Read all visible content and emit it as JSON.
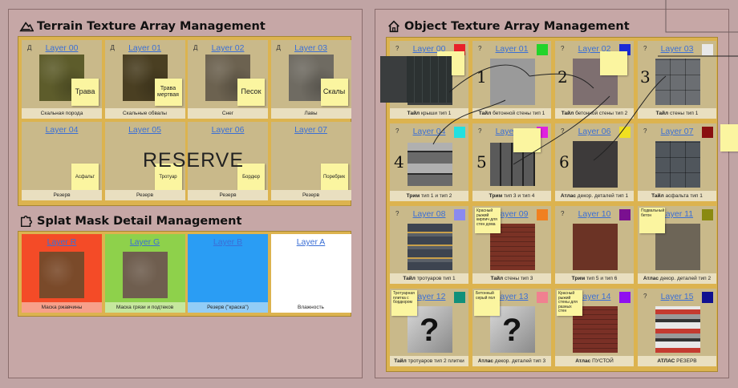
{
  "terrain": {
    "title": "Terrain Texture Array Management",
    "layers": [
      {
        "name": "Layer 00",
        "mark": "Д",
        "note": "Трава",
        "caption": "Скальная порода",
        "tex": "#5d5c2b"
      },
      {
        "name": "Layer 01",
        "mark": "Д",
        "note": "Трава мертвая",
        "caption": "Скальные обвалы",
        "tex": "#4a3f22"
      },
      {
        "name": "Layer 02",
        "mark": "Д",
        "note": "Песок",
        "caption": "Снег",
        "tex": "#6c6250"
      },
      {
        "name": "Layer 03",
        "mark": "Д",
        "note": "Скалы",
        "caption": "Лавы",
        "tex": "#6f6b62"
      },
      {
        "name": "Layer 04",
        "mark": "",
        "note": "Асфальт",
        "caption": "Резерв",
        "tex": ""
      },
      {
        "name": "Layer 05",
        "mark": "",
        "note": "Тротуар",
        "caption": "Резерв",
        "tex": ""
      },
      {
        "name": "Layer 06",
        "mark": "",
        "note": "Бордюр",
        "caption": "Резерв",
        "tex": ""
      },
      {
        "name": "Layer 07",
        "mark": "",
        "note": "Поребрик",
        "caption": "Резерв",
        "tex": ""
      }
    ],
    "reserve_text": "RESERVE"
  },
  "splat": {
    "title": "Splat Mask Detail Management",
    "layers": [
      {
        "name": "Layer R",
        "caption": "Маска ржавчины",
        "bg": "#f44b27",
        "capbg": "#f7a08a",
        "tex": "#7a4a2a"
      },
      {
        "name": "Layer G",
        "caption": "Маска грязи и подтеков",
        "bg": "#8ed14b",
        "capbg": "#c6e79e",
        "tex": "#6f5e4f"
      },
      {
        "name": "Layer B",
        "caption": "Резерв (\"краска\")",
        "bg": "#2a9df4",
        "capbg": "#93cdf6",
        "tex": ""
      },
      {
        "name": "Layer A",
        "caption": "Влажность",
        "bg": "#ffffff",
        "capbg": "#ffffff",
        "tex": ""
      }
    ]
  },
  "object": {
    "title": "Object Texture Array Management",
    "layers": [
      {
        "name": "Layer 00",
        "mark": "?",
        "color": "#e8202a",
        "caption_b": "Тайл",
        "caption": "крыши тип 1",
        "tex": "#3c3f3f"
      },
      {
        "name": "Layer 01",
        "mark": "?",
        "color": "#22d42a",
        "caption_b": "Тайл",
        "caption": "бетонной стены тип 1",
        "tex": "#9a9a9a"
      },
      {
        "name": "Layer 02",
        "mark": "?",
        "color": "#1a2bd6",
        "caption_b": "Тайл",
        "caption": "бетонной стены тип 2",
        "tex": "#7e6f70"
      },
      {
        "name": "Layer 03",
        "mark": "?",
        "color": "#e8e8e8",
        "caption_b": "Тайл",
        "caption": "стены тип 1",
        "tex": "#6b6e72"
      },
      {
        "name": "Layer 04",
        "mark": "?",
        "color": "#22e0e0",
        "caption_b": "Трим",
        "caption": "тип 1 и тип 2",
        "tex": "#8c8c8c"
      },
      {
        "name": "Layer 05",
        "mark": "?",
        "color": "#e020e0",
        "caption_b": "Трим",
        "caption": "тип 3 и тип 4",
        "tex": "#8a8a8a"
      },
      {
        "name": "Layer 06",
        "mark": "?",
        "color": "#f0e020",
        "caption_b": "Атлас",
        "caption": "декор. деталей тип 1",
        "tex": "#3d3a3a"
      },
      {
        "name": "Layer 07",
        "mark": "?",
        "color": "#8a1010",
        "caption_b": "Тайл",
        "caption": "асфальта тип 1",
        "tex": "#50565c"
      },
      {
        "name": "Layer 08",
        "mark": "?",
        "color": "#8a8af0",
        "caption_b": "Тайл",
        "caption": "тротуаров тип 1",
        "tex": "#4a4f56"
      },
      {
        "name": "Layer 09",
        "mark": "?",
        "color": "#f08020",
        "caption_b": "Тайл",
        "caption": "стены тип 3",
        "tex": "#7a3225"
      },
      {
        "name": "Layer 10",
        "mark": "?",
        "color": "#7a1090",
        "caption_b": "Трим",
        "caption": "тип 5 и тип 6",
        "tex": "#6b3325"
      },
      {
        "name": "Layer 11",
        "mark": "?",
        "color": "#8a8a10",
        "caption_b": "Атлас",
        "caption": "декор. деталей тип 2",
        "tex": "#6d6557"
      },
      {
        "name": "Layer 12",
        "mark": "?",
        "color": "#10907a",
        "caption_b": "Тайл",
        "caption": "тротуаров тип 2 плитки",
        "tex": "#b8b8b8"
      },
      {
        "name": "Layer 13",
        "mark": "?",
        "color": "#f08090",
        "caption_b": "Атлас",
        "caption": "декор. деталей тип 3",
        "tex": "#5c6464"
      },
      {
        "name": "Layer 14",
        "mark": "?",
        "color": "#9010f0",
        "caption_b": "Атлас",
        "caption": "ПУСТОЙ",
        "tex": "#7a3026"
      },
      {
        "name": "Layer 15",
        "mark": "?",
        "color": "#101090",
        "caption_b": "АТЛАС",
        "caption": "РЕЗЕРВ",
        "tex": "#b0b0b0"
      }
    ],
    "numbers": [
      "1",
      "2",
      "3",
      "4",
      "5",
      "6"
    ],
    "notes": {
      "n9": "Красный рыжий кирпич для стен дома",
      "n11": "Подвальный бетон",
      "n12": "Тротуарная плитка с бордюром",
      "n13": "Бетонный серый пол",
      "n14": "Красный рыжий стены для разных стен"
    },
    "question_mark": "?"
  }
}
